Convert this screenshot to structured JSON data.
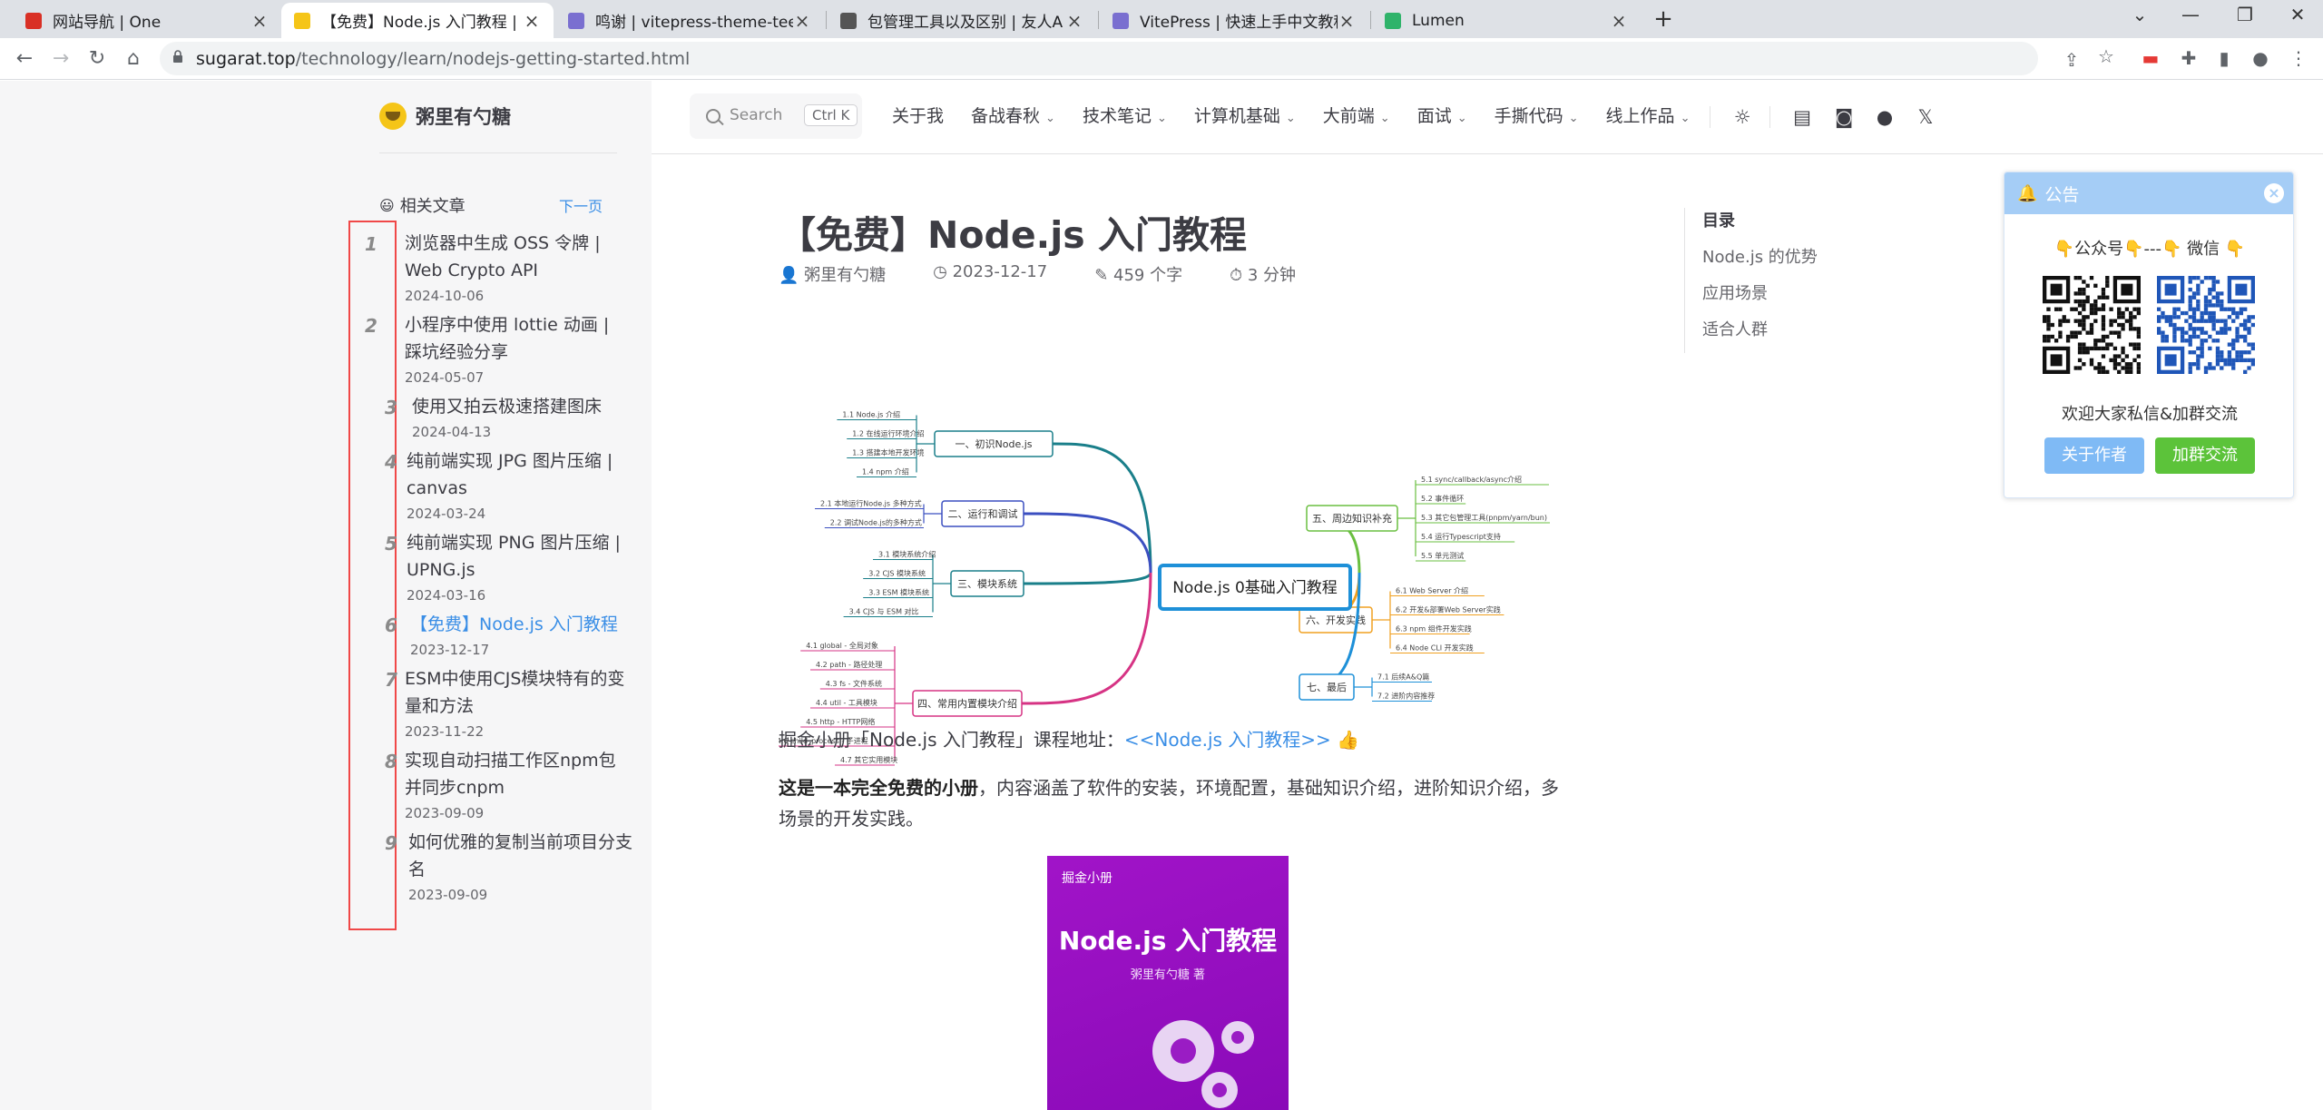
{
  "browser": {
    "tabs": [
      {
        "title": "网站导航 | One",
        "favicon_color": "#d93025",
        "active": false
      },
      {
        "title": "【免费】Node.js 入门教程 | 粥里",
        "favicon_color": "#f5c518",
        "active": true
      },
      {
        "title": "鸣谢 | vitepress-theme-teek",
        "favicon_color": "#7a6fd0",
        "active": false
      },
      {
        "title": "包管理工具以及区别 | 友人A",
        "favicon_color": "#555555",
        "active": false
      },
      {
        "title": "VitePress | 快速上手中文教程",
        "favicon_color": "#7a6fd0",
        "active": false
      },
      {
        "title": "Lumen",
        "favicon_color": "#2fb36a",
        "active": false
      }
    ],
    "url_host": "sugarat.top",
    "url_path": "/technology/learn/nodejs-getting-started.html"
  },
  "sidebar": {
    "brand": "粥里有勺糖",
    "related_title": "相关文章",
    "next_label": "下一页",
    "articles": [
      {
        "index": "1",
        "title": "浏览器中生成 OSS 令牌 | Web Crypto API",
        "date": "2024-10-06",
        "current": false
      },
      {
        "index": "2",
        "title": "小程序中使用 lottie 动画 | 踩坑经验分享",
        "date": "2024-05-07",
        "current": false
      },
      {
        "index": "3",
        "title": "使用又拍云极速搭建图床",
        "date": "2024-04-13",
        "current": false
      },
      {
        "index": "4",
        "title": "纯前端实现 JPG 图片压缩 | canvas",
        "date": "2024-03-24",
        "current": false
      },
      {
        "index": "5",
        "title": "纯前端实现 PNG 图片压缩 | UPNG.js",
        "date": "2024-03-16",
        "current": false
      },
      {
        "index": "6",
        "title": "【免费】Node.js 入门教程",
        "date": "2023-12-17",
        "current": true
      },
      {
        "index": "7",
        "title": "ESM中使用CJS模块特有的变量和方法",
        "date": "2023-11-22",
        "current": false
      },
      {
        "index": "8",
        "title": "实现自动扫描工作区npm包并同步cnpm",
        "date": "2023-09-09",
        "current": false
      },
      {
        "index": "9",
        "title": "如何优雅的复制当前项目分支名",
        "date": "2023-09-09",
        "current": false
      }
    ]
  },
  "navbar": {
    "search_placeholder": "Search",
    "search_shortcut": "Ctrl K",
    "items": [
      {
        "label": "关于我",
        "dropdown": false
      },
      {
        "label": "备战春秋",
        "dropdown": true
      },
      {
        "label": "技术笔记",
        "dropdown": true
      },
      {
        "label": "计算机基础",
        "dropdown": true
      },
      {
        "label": "大前端",
        "dropdown": true
      },
      {
        "label": "面试",
        "dropdown": true
      },
      {
        "label": "手撕代码",
        "dropdown": true
      },
      {
        "label": "线上作品",
        "dropdown": true
      }
    ]
  },
  "doc": {
    "title": "【免费】Node.js 入门教程",
    "author": "粥里有勺糖",
    "date": "2023-12-17",
    "words": "459 个字",
    "read_time": "3 分钟",
    "p1_text": "掘金小册「Node.js 入门教程」课程地址：",
    "p1_link": "<<Node.js 入门教程>>",
    "p2_bold": "这是一本完全免费的小册",
    "p2_rest": "，内容涵盖了软件的安装，环境配置，基础知识介绍，进阶知识介绍，多场景的开发实践。",
    "cover": {
      "publisher": "掘金小册",
      "title": "Node.js 入门教程",
      "author": "粥里有勺糖 著"
    }
  },
  "mindmap": {
    "center": "Node.js 0基础入门教程",
    "branches": [
      {
        "label": "一、初识Node.js",
        "color": "#1a7f8a",
        "leaves": [
          "1.1 Node.js 介绍",
          "1.2 在线运行环境介绍",
          "1.3 搭建本地开发环境",
          "1.4 npm 介绍"
        ]
      },
      {
        "label": "二、运行和调试",
        "color": "#3b4fc0",
        "leaves": [
          "2.1 本地运行Node.js 多种方式",
          "2.2 调试Node.js的多种方式"
        ]
      },
      {
        "label": "三、模块系统",
        "color": "#1a7f8a",
        "leaves": [
          "3.1 模块系统介绍",
          "3.2 CJS 模块系统",
          "3.3 ESM 模块系统",
          "3.4 CJS 与 ESM 对比"
        ]
      },
      {
        "label": "四、常用内置模块介绍",
        "color": "#d63384",
        "leaves": [
          "4.1 global - 全局对象",
          "4.2 path - 路径处理",
          "4.3 fs - 文件系统",
          "4.4 util - 工具模块",
          "4.5 http - HTTP网络",
          "4.6 child_process - 子进程",
          "4.7 其它实用模块"
        ]
      },
      {
        "label": "五、周边知识补充",
        "color": "#6abf40",
        "leaves": [
          "5.1 sync/callback/async介绍",
          "5.2 事件循环",
          "5.3 其它包管理工具(pnpm/yarn/bun)",
          "5.4 运行Typescript支持",
          "5.5 单元测试"
        ]
      },
      {
        "label": "六、开发实践",
        "color": "#f0a020",
        "leaves": [
          "6.1 Web Server 介绍",
          "6.2 开发&部署Web Server实践",
          "6.3 npm 组件开发实践",
          "6.4 Node CLI 开发实践"
        ]
      },
      {
        "label": "七、最后",
        "color": "#1e90d8",
        "leaves": [
          "7.1 后续A&Q篇",
          "7.2 进阶内容推荐"
        ]
      }
    ]
  },
  "toc": {
    "title": "目录",
    "items": [
      "Node.js 的优势",
      "应用场景",
      "适合人群"
    ]
  },
  "notice": {
    "title": "公告",
    "subtitle": "👇公众号👇---👇 微信 👇",
    "welcome": "欢迎大家私信&加群交流",
    "btn_about": "关于作者",
    "btn_group": "加群交流",
    "btn_about_color": "#7fbaf5",
    "btn_group_color": "#5cc33a"
  }
}
